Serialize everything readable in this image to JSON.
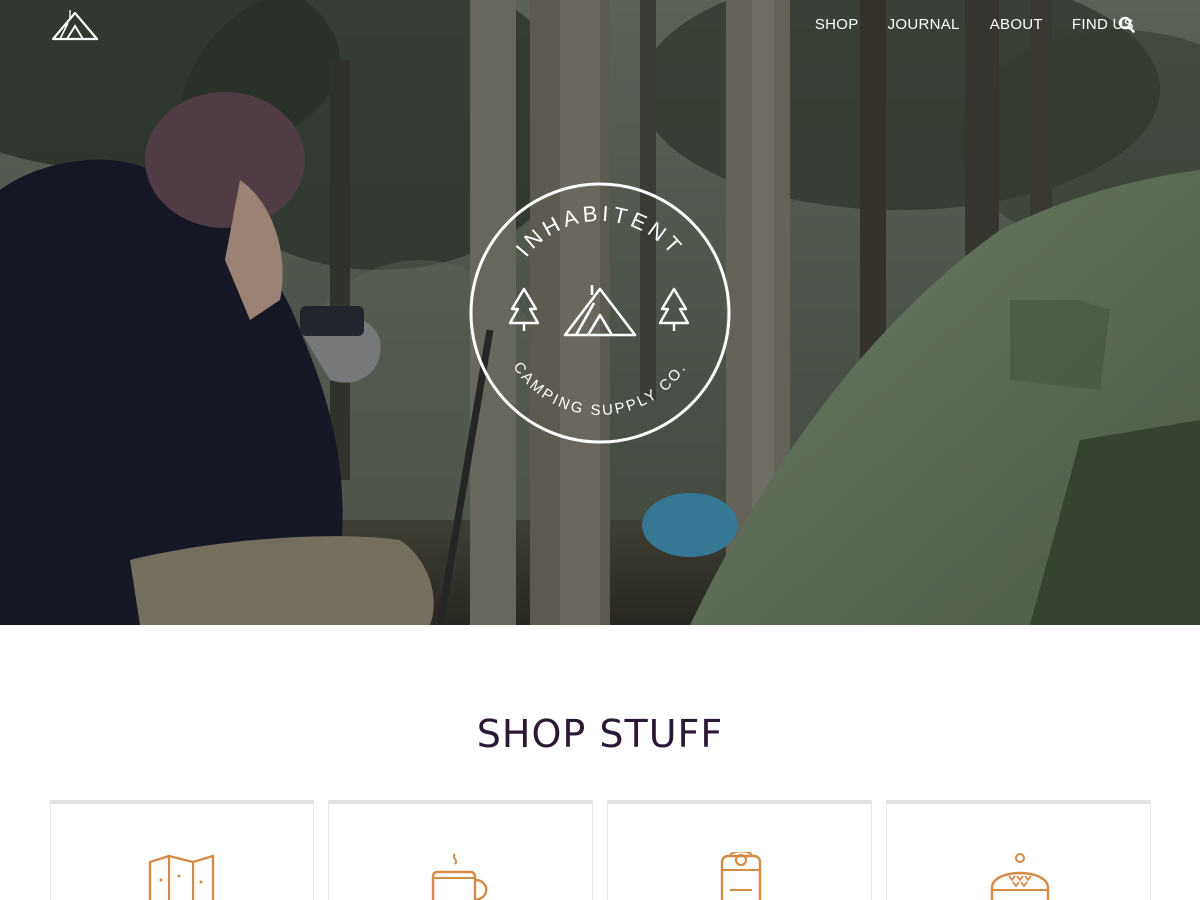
{
  "nav": {
    "logo_icon": "tent-logo-icon",
    "items": [
      {
        "label": "SHOP"
      },
      {
        "label": "JOURNAL"
      },
      {
        "label": "ABOUT"
      },
      {
        "label": "FIND US"
      }
    ],
    "search_icon": "search-icon"
  },
  "hero": {
    "badge": {
      "top_text": "INHABITENT",
      "bottom_text": "CAMPING SUPPLY CO."
    }
  },
  "shop": {
    "title": "SHOP STUFF",
    "categories": [
      {
        "icon": "map-icon"
      },
      {
        "icon": "mug-icon"
      },
      {
        "icon": "sleeping-bag-icon"
      },
      {
        "icon": "beanie-icon"
      }
    ]
  },
  "colors": {
    "accent": "#d58a45",
    "title": "#2a1835",
    "card_border": "#e2e2e2"
  }
}
